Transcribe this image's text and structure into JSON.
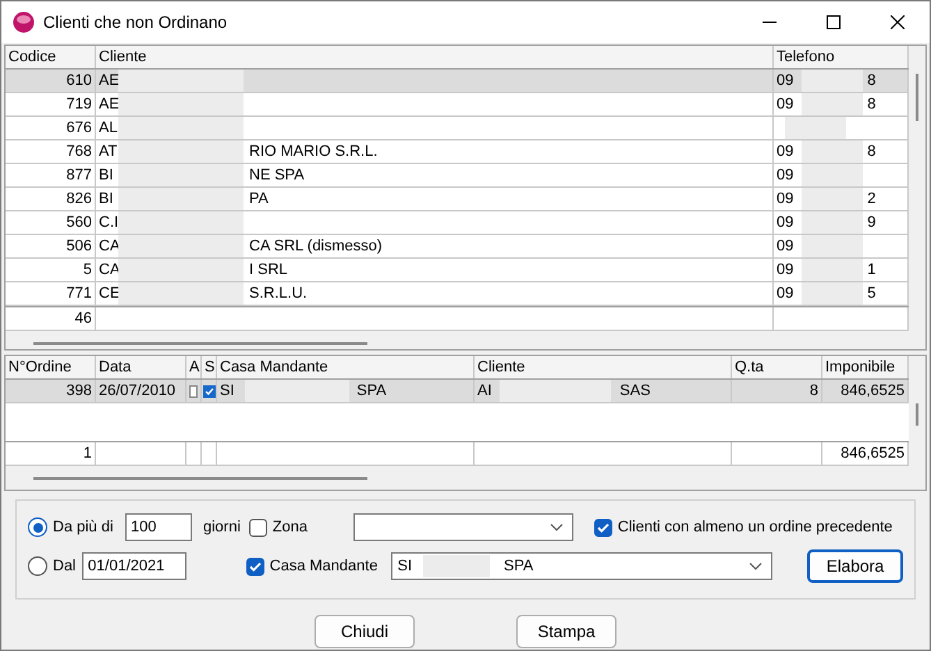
{
  "window": {
    "title": "Clienti che non Ordinano"
  },
  "clients_table": {
    "columns": [
      "Codice",
      "Cliente",
      "Telefono"
    ],
    "rows": [
      {
        "codice": "610",
        "cliente_start": "AE",
        "telefono_start": "09",
        "telefono_end": "8",
        "selected": true
      },
      {
        "codice": "719",
        "cliente_start": "AE",
        "telefono_start": "09",
        "telefono_end": "8",
        "selected": false
      },
      {
        "codice": "676",
        "cliente_start": "AL",
        "selected": false
      },
      {
        "codice": "768",
        "cliente_start": "AT",
        "cliente_end": "RIO MARIO S.R.L.",
        "telefono_start": "09",
        "telefono_end": "8",
        "selected": false
      },
      {
        "codice": "877",
        "cliente_start": "BI",
        "cliente_end": "NE SPA",
        "telefono_start": "09",
        "selected": false
      },
      {
        "codice": "826",
        "cliente_start": "BI",
        "cliente_end": "PA",
        "telefono_start": "09",
        "telefono_end": "2",
        "selected": false
      },
      {
        "codice": "560",
        "cliente_start": "C.I",
        "telefono_start": "09",
        "telefono_end": "9",
        "selected": false
      },
      {
        "codice": "506",
        "cliente_start": "CA",
        "cliente_end": "CA SRL (dismesso)",
        "telefono_start": "09",
        "selected": false
      },
      {
        "codice": "5",
        "cliente_start": "CA",
        "cliente_end": "I SRL",
        "telefono_start": "09",
        "telefono_end": "1",
        "selected": false
      },
      {
        "codice": "771",
        "cliente_start": "CE",
        "cliente_end": "S.R.L.U.",
        "telefono_start": "09",
        "telefono_end": "5",
        "selected": false
      }
    ],
    "total": {
      "codice": "46"
    }
  },
  "orders_table": {
    "columns": [
      "N°Ordine",
      "Data",
      "A",
      "S",
      "Casa Mandante",
      "Cliente",
      "Q.ta",
      "Imponibile"
    ],
    "rows": [
      {
        "n_ordine": "398",
        "data": "26/07/2010",
        "a": false,
        "s": true,
        "casa_start": "SI",
        "casa_end": "SPA",
        "cliente_start": "AI",
        "cliente_end": "SAS",
        "qta": "8",
        "imponibile": "846,6525",
        "selected": true
      }
    ],
    "total": {
      "n_ordine": "1",
      "imponibile": "846,6525"
    }
  },
  "filters": {
    "radio_options": [
      {
        "label": "Da più di",
        "selected": true,
        "value": "100",
        "suffix": "giorni"
      },
      {
        "label": "Dal",
        "selected": false,
        "value": "01/01/2021"
      }
    ],
    "zona": {
      "label": "Zona",
      "checked": false
    },
    "clienti_precedente": {
      "label": "Clienti con almeno un ordine precedente",
      "checked": true
    },
    "casa_mandante": {
      "label": "Casa Mandante",
      "checked": true,
      "value_start": "SI",
      "value_end": "SPA"
    },
    "elabora": "Elabora"
  },
  "buttons": [
    "Chiudi",
    "Stampa"
  ]
}
